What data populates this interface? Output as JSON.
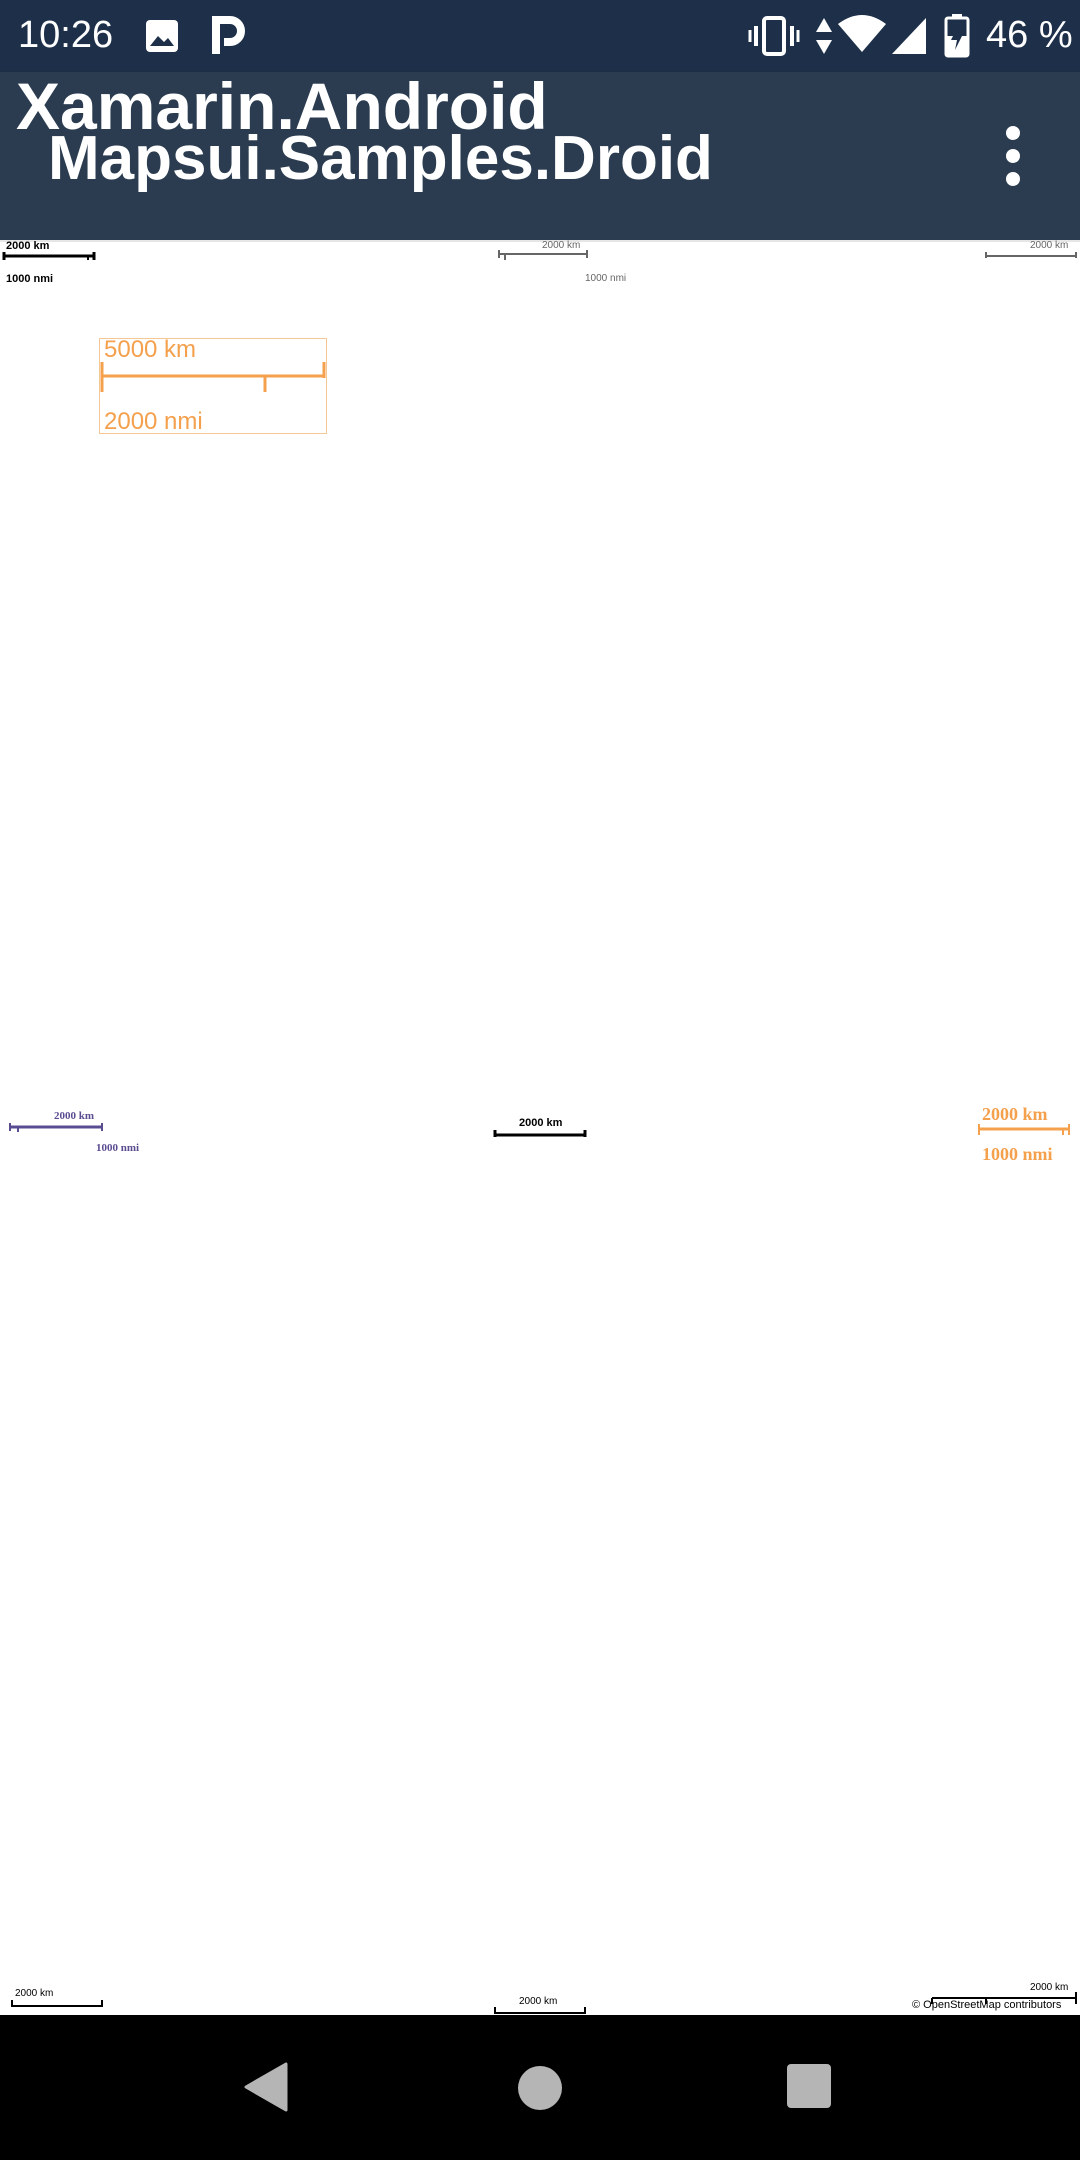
{
  "status_bar": {
    "time": "10:26",
    "icons": [
      "image-icon",
      "parking-app-icon",
      "vibrate-icon",
      "data-arrows-icon",
      "wifi-icon",
      "signal-icon",
      "battery-charging-icon"
    ],
    "battery": "46 %"
  },
  "app_bar": {
    "title": "Xamarin.Android",
    "subtitle": "Mapsui.Samples.Droid",
    "menu_icon": "more-vert-icon"
  },
  "map": {
    "scalebars": {
      "top_left": {
        "top": "2000 km",
        "bottom": "1000 nmi"
      },
      "top_center": {
        "top": "2000 km",
        "bottom": "1000 nmi"
      },
      "top_right": {
        "top": "2000 km"
      },
      "custom_orange": {
        "top": "5000 km",
        "bottom": "2000 nmi"
      },
      "middle_left": {
        "top": "2000 km",
        "bottom": "1000 nmi"
      },
      "middle_center": {
        "top": "2000 km"
      },
      "middle_right": {
        "top": "2000 km",
        "bottom": "1000 nmi"
      },
      "bottom_left": {
        "top": "2000 km"
      },
      "bottom_center": {
        "top": "2000 km"
      },
      "bottom_right": {
        "top": "2000 km"
      }
    },
    "attribution": "© OpenStreetMap contributors",
    "colors": {
      "orange": "#f4a04d",
      "purple": "#5a4c91",
      "black": "#000000",
      "gray": "#666666"
    }
  },
  "nav_bar": {
    "back": "back-icon",
    "home": "home-icon",
    "recents": "recents-icon"
  }
}
